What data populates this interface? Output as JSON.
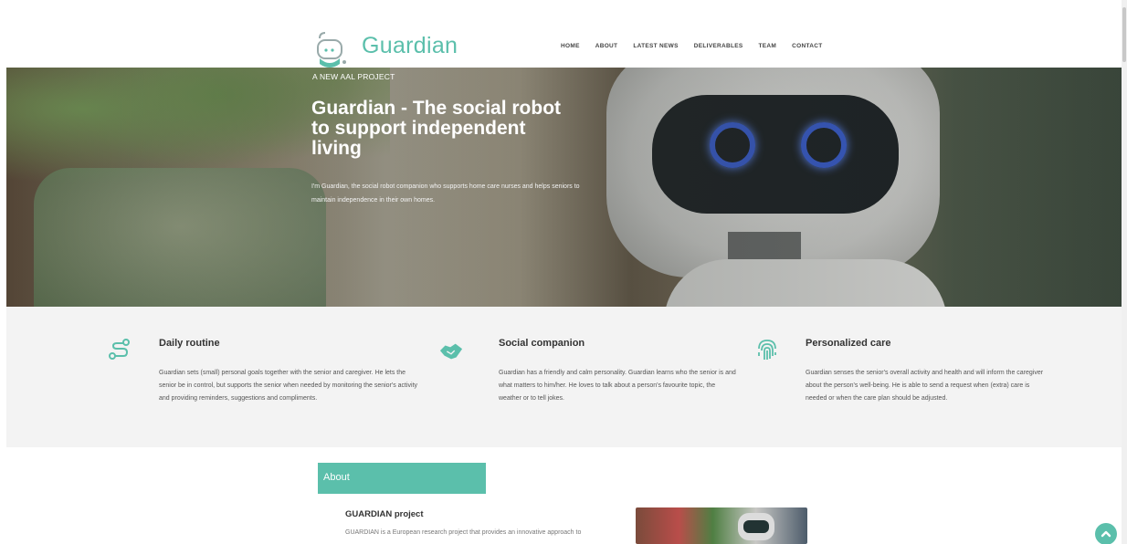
{
  "brand": {
    "name": "Guardian",
    "accent": "#5bbfab"
  },
  "nav": {
    "items": [
      {
        "label": "HOME"
      },
      {
        "label": "ABOUT"
      },
      {
        "label": "LATEST NEWS"
      },
      {
        "label": "DELIVERABLES"
      },
      {
        "label": "TEAM"
      },
      {
        "label": "CONTACT"
      }
    ]
  },
  "hero": {
    "kicker": "A NEW AAL PROJECT",
    "title": "Guardian - The social robot to support independent living",
    "description": "I'm Guardian, the social robot companion who supports home care nurses and helps seniors to maintain independence in their own homes."
  },
  "features": [
    {
      "icon": "route-icon",
      "title": "Daily routine",
      "text": "Guardian sets (small) personal goals together with the senior and caregiver. He lets the senior be in control, but supports the senior when needed by monitoring the senior's activity and providing reminders, suggestions and compliments."
    },
    {
      "icon": "handshake-icon",
      "title": "Social companion",
      "text": "Guardian has a friendly and calm personality. Guardian learns who the senior is and what matters to him/her. He loves to talk about a person's favourite topic, the weather or to tell jokes."
    },
    {
      "icon": "fingerprint-icon",
      "title": "Personalized care",
      "text": "Guardian senses the senior's overall activity and health and will inform the caregiver about the person's well-being. He is able to send a request when (extra) care is needed or when the care plan should be adjusted."
    }
  ],
  "about": {
    "tab_label": "About",
    "subtitle": "GUARDIAN project",
    "text": "GUARDIAN is a European research project that provides an innovative approach to"
  },
  "scroll_top": {
    "icon": "chevron-up-icon"
  }
}
